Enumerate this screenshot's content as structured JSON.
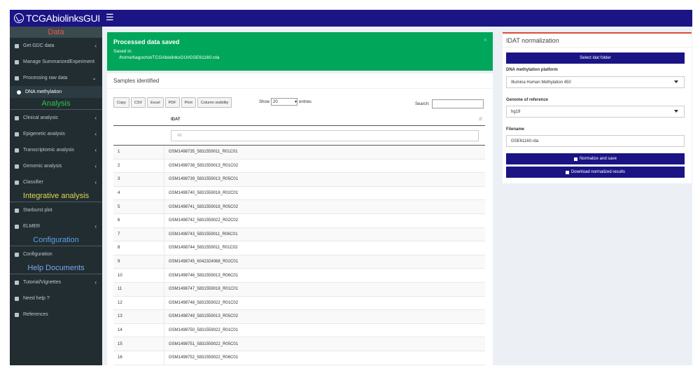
{
  "app": {
    "title": "TCGAbiolinksGUI"
  },
  "sidebar": {
    "sections": {
      "data": "Data",
      "analysis": "Analysis",
      "integrative": "Integrative analysis",
      "configuration": "Configuration",
      "help": "Help Documents"
    },
    "items": [
      {
        "label": "Get GDC data",
        "icon": "table-icon"
      },
      {
        "label": "Manage SummarizedExperiment",
        "icon": "pencil-icon"
      },
      {
        "label": "Processing raw data",
        "icon": "gears-icon"
      },
      {
        "label": "DNA methylation",
        "icon": "gear-icon"
      },
      {
        "label": "Clinical analysis",
        "icon": "flask-icon"
      },
      {
        "label": "Epigenetic analysis",
        "icon": "flask-icon"
      },
      {
        "label": "Transcriptomic analysis",
        "icon": "flask-icon"
      },
      {
        "label": "Genomic analysis",
        "icon": "flask-icon"
      },
      {
        "label": "Classifier",
        "icon": "tag-icon"
      },
      {
        "label": "Starburst plot",
        "icon": "image-icon"
      },
      {
        "label": "ELMER",
        "icon": "flask-icon"
      },
      {
        "label": "Configuration",
        "icon": "gears-icon"
      },
      {
        "label": "Tutorial/Vignettes",
        "icon": "book-icon"
      },
      {
        "label": "Need help ?",
        "icon": "question-icon"
      },
      {
        "label": "References",
        "icon": "file-icon"
      }
    ]
  },
  "alert": {
    "title": "Processed data saved",
    "saved_in": "Saved in:",
    "path": "/home/tiagochst/TCGAbiolinksGUI/GSE61160.rda"
  },
  "samples": {
    "header": "Samples identified",
    "buttons": [
      "Copy",
      "CSV",
      "Excel",
      "PDF",
      "Print",
      "Column visibility"
    ],
    "show_label": "Show",
    "show_value": "20",
    "entries_label": "entries",
    "search_label": "Search:",
    "column": "IDAT",
    "filter_placeholder": "All",
    "rows": [
      {
        "n": "1",
        "v": "GSM1498735_5831559011_R01C01"
      },
      {
        "n": "2",
        "v": "GSM1498738_5831559013_R01C02"
      },
      {
        "n": "3",
        "v": "GSM1498739_5831559013_R05C01"
      },
      {
        "n": "4",
        "v": "GSM1498740_5831559018_R02C01"
      },
      {
        "n": "5",
        "v": "GSM1498741_5831559018_R05C02"
      },
      {
        "n": "6",
        "v": "GSM1498742_5831559022_R02C02"
      },
      {
        "n": "7",
        "v": "GSM1498743_5831559011_R06C01"
      },
      {
        "n": "8",
        "v": "GSM1498744_5831559011_R01C02"
      },
      {
        "n": "9",
        "v": "GSM1498745_6042324068_R02C01"
      },
      {
        "n": "10",
        "v": "GSM1498746_5831559013_R06C01"
      },
      {
        "n": "11",
        "v": "GSM1498747_5831559018_R01C01"
      },
      {
        "n": "12",
        "v": "GSM1498748_5831559022_R01C02"
      },
      {
        "n": "13",
        "v": "GSM1498749_5831559013_R05C02"
      },
      {
        "n": "14",
        "v": "GSM1498750_5831559022_R01C01"
      },
      {
        "n": "15",
        "v": "GSM1498751_5831559022_R05C01"
      },
      {
        "n": "16",
        "v": "GSM1498752_5831559022_R06C01"
      }
    ]
  },
  "idat": {
    "header": "IDAT normalization",
    "select_folder": "Select idat folder",
    "platform_label": "DNA methylation platform",
    "platform_value": "Illumina Human Methylation 450",
    "genome_label": "Genome of reference",
    "genome_value": "hg19",
    "filename_label": "Filename",
    "filename_value": "GSE61160.rda",
    "normalize_label": "Normalize and save",
    "download_label": "Download normalized results"
  }
}
